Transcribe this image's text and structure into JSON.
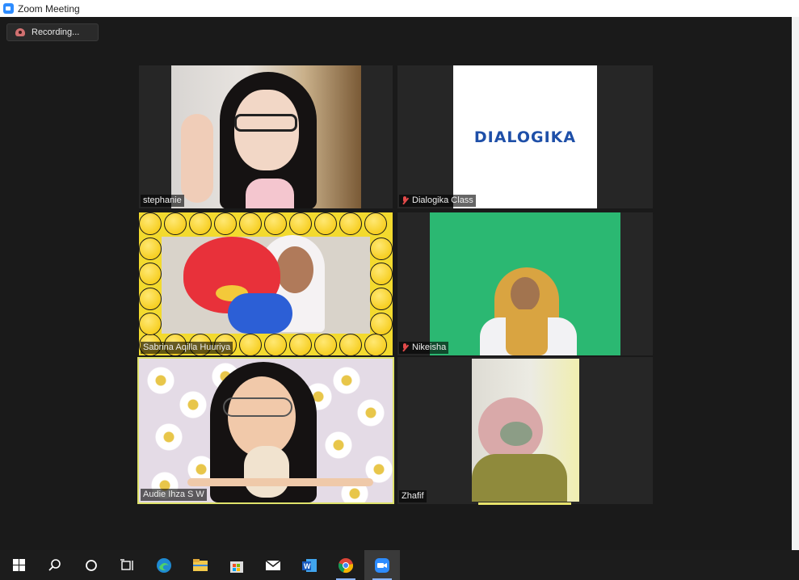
{
  "window": {
    "title": "Zoom Meeting"
  },
  "recording": {
    "label": "Recording..."
  },
  "participants": [
    {
      "name": "stephanie",
      "muted": false
    },
    {
      "name": "Dialogika Class",
      "muted": true
    },
    {
      "name": "Sabrina Aqilla Huuriya",
      "muted": false
    },
    {
      "name": "Nikeisha",
      "muted": true
    },
    {
      "name": "Audie Ihza S W",
      "muted": false
    },
    {
      "name": "Zhafif",
      "muted": false
    }
  ],
  "dialogika_logo_text": "DIALOGIKA",
  "taskbar": {
    "items": [
      "windows-start",
      "search",
      "cortana",
      "task-view",
      "edge",
      "file-explorer",
      "microsoft-store",
      "mail",
      "word",
      "chrome",
      "zoom"
    ],
    "active": "zoom"
  },
  "colors": {
    "meeting_bg": "#1a1a1a",
    "active_speaker": "#dfe36b",
    "zoom_blue": "#2D8CFF",
    "mute_red": "#e24a4a"
  }
}
